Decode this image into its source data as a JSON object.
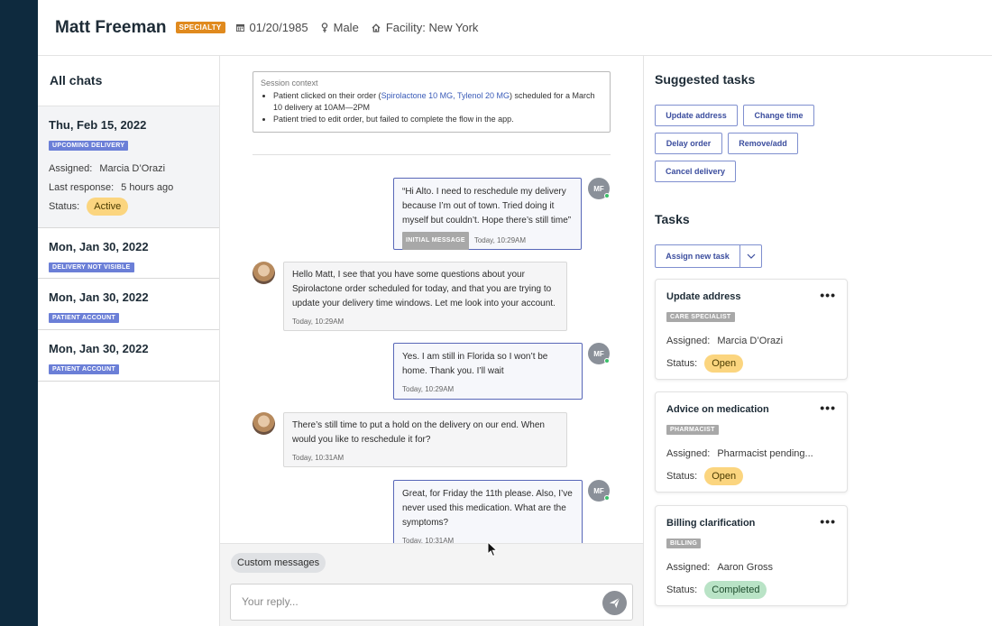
{
  "colors": {
    "sidebar": "#0e2a3e",
    "accent": "#3b4d9e",
    "specialty": "#e08a1e",
    "tag_blue": "#6b7fd7",
    "open": "#fbd57f",
    "completed": "#b9e3c6"
  },
  "patient": {
    "name": "Matt Freeman",
    "badge": "SPECIALTY",
    "dob": "01/20/1985",
    "gender": "Male",
    "facility": "Facility: New York",
    "icons": [
      "calendar-icon",
      "gender-icon",
      "home-icon"
    ]
  },
  "chats": {
    "title": "All chats",
    "items": [
      {
        "date": "Thu, Feb 15, 2022",
        "tag": "UPCOMING DELIVERY",
        "assigned_label": "Assigned:",
        "assigned": "Marcia D’Orazi",
        "last_label": "Last response:",
        "last": "5 hours ago",
        "status_label": "Status:",
        "status": "Active"
      },
      {
        "date": "Mon, Jan 30, 2022",
        "tag": "DELIVERY NOT VISIBLE"
      },
      {
        "date": "Mon, Jan 30, 2022",
        "tag": "PATIENT ACCOUNT"
      },
      {
        "date": "Mon, Jan 30, 2022",
        "tag": "PATIENT ACCOUNT"
      }
    ]
  },
  "session": {
    "title": "Session context",
    "line1_pre": "Patient clicked on their order (",
    "line1_link": "Spirolactone 10 MG, Tylenol 20 MG",
    "line1_post": ") scheduled for a March 10 delivery at 10AM—2PM",
    "line2": "Patient tried to edit order, but failed to complete the flow in the app."
  },
  "messages": [
    {
      "text": "“Hi Alto. I need to reschedule my delivery because I’m out of town. Tried doing it myself but couldn’t. Hope there’s still time”",
      "tag": "INITIAL MESSAGE",
      "time": "Today, 10:29AM",
      "avatar": "MF"
    },
    {
      "text": "Hello Matt, I see that you have some questions about your Spirolactone order scheduled for today, and that you are trying to update your delivery time windows. Let me look into your account.",
      "time": "Today, 10:29AM"
    },
    {
      "text": "Yes. I am still in Florida so I won’t be home. Thank you. I’ll wait",
      "time": "Today, 10:29AM",
      "avatar": "MF"
    },
    {
      "text": "There’s still time to put a hold on the delivery on our end. When would you like to reschedule it for?",
      "time": "Today, 10:31AM"
    },
    {
      "text": "Great, for Friday the 11th please. Also, I’ve never used this medication. What are the symptoms?",
      "time": "Today, 10:31AM",
      "avatar": "MF"
    }
  ],
  "compose": {
    "custom": "Custom messages",
    "placeholder": "Your reply..."
  },
  "suggested": {
    "title": "Suggested tasks",
    "buttons": [
      "Update address",
      "Change time",
      "Delay order",
      "Remove/add",
      "Cancel delivery"
    ]
  },
  "tasks": {
    "title": "Tasks",
    "assign": "Assign new task",
    "cards": [
      {
        "title": "Update address",
        "tag": "CARE SPECIALIST",
        "assigned_label": "Assigned:",
        "assigned": "Marcia D’Orazi",
        "status_label": "Status:",
        "status": "Open"
      },
      {
        "title": "Advice on medication",
        "tag": "PHARMACIST",
        "assigned_label": "Assigned:",
        "assigned": "Pharmacist pending...",
        "status_label": "Status:",
        "status": "Open"
      },
      {
        "title": "Billing clarification",
        "tag": "BILLING",
        "assigned_label": "Assigned:",
        "assigned": "Aaron Gross",
        "status_label": "Status:",
        "status": "Completed"
      }
    ]
  }
}
